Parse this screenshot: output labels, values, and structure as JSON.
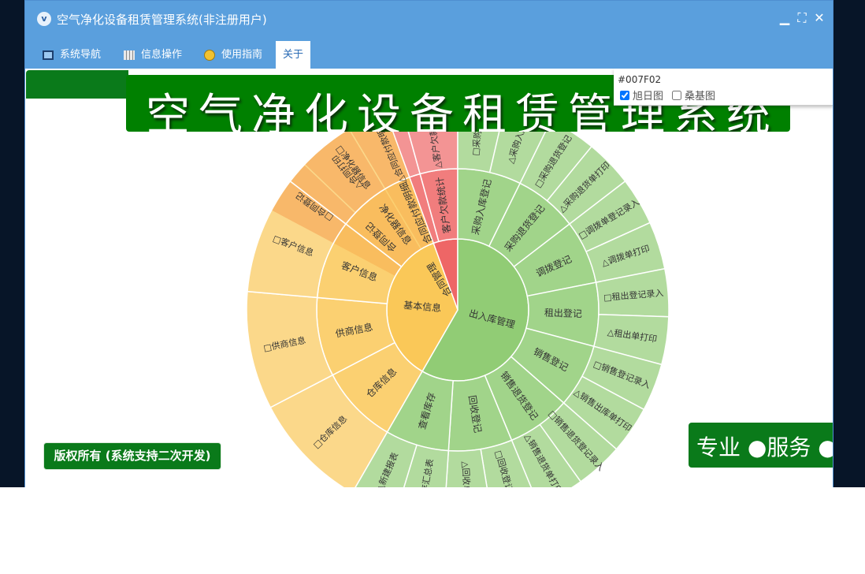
{
  "window": {
    "title": "空气净化设备租赁管理系统(非注册用户)",
    "logo_text": "v",
    "controls": {
      "minimize": "▁",
      "maximize": "⛶",
      "close": "✕"
    }
  },
  "menu": [
    {
      "label": "系统导航",
      "icon": "monitor-icon"
    },
    {
      "label": "信息操作",
      "icon": "grid-icon"
    },
    {
      "label": "使用指南",
      "icon": "help-icon"
    },
    {
      "label": "关于",
      "icon": ""
    }
  ],
  "banner": {
    "title": "空气净化设备租赁管理系统"
  },
  "popup": {
    "color": "#007F02",
    "options": [
      {
        "label": "旭日图",
        "checked": true
      },
      {
        "label": "桑基图",
        "checked": false
      }
    ]
  },
  "copyright": "版权所有 (系统支持二次开发)",
  "motto": "专业 ●服务 ●价",
  "colors": {
    "red": "#ee6666",
    "yellow": "#fac858",
    "green": "#91cc75",
    "titlebar": "#5a9fdd",
    "banner": "#008000"
  },
  "chart_data": {
    "type": "sunburst",
    "series": [
      {
        "name": "合同管理",
        "children": [
          {
            "name": "合同登记",
            "children": [
              {
                "name": "□合同登记"
              },
              {
                "name": "△合同打印"
              }
            ]
          },
          {
            "name": "合同应付款明细",
            "children": [
              {
                "name": "△合同应付款明细表"
              }
            ]
          },
          {
            "name": "客户欠款统计",
            "children": [
              {
                "name": "△客户欠款统计表"
              }
            ]
          }
        ]
      },
      {
        "name": "出入库管理",
        "children": [
          {
            "name": "采购入库登记",
            "children": [
              {
                "name": "□采购入库"
              },
              {
                "name": "△采购入库"
              }
            ]
          },
          {
            "name": "采购退货登记",
            "children": [
              {
                "name": "□采购退货登记"
              },
              {
                "name": "△采购退货单打印"
              }
            ]
          },
          {
            "name": "调拨登记",
            "children": [
              {
                "name": "□调拨单登记录入"
              },
              {
                "name": "△调拨单打印"
              }
            ]
          },
          {
            "name": "租出登记",
            "children": [
              {
                "name": "□租出登记录入"
              },
              {
                "name": "△租出单打印"
              }
            ]
          },
          {
            "name": "销售登记",
            "children": [
              {
                "name": "□销售登记录入"
              },
              {
                "name": "△销售出库单打印"
              }
            ]
          },
          {
            "name": "销售退货登记",
            "children": [
              {
                "name": "□销售退货登记录入"
              },
              {
                "name": "△销售退货单打印"
              }
            ]
          },
          {
            "name": "回收登记",
            "children": [
              {
                "name": "□回收登记录入"
              },
              {
                "name": "△回收单打印"
              }
            ]
          },
          {
            "name": "查看库存",
            "children": [
              {
                "name": "△库存汇总表"
              },
              {
                "name": "△新建报表"
              }
            ]
          }
        ]
      },
      {
        "name": "基本信息",
        "children": [
          {
            "name": "仓库信息",
            "children": [
              {
                "name": "□仓库信息"
              }
            ]
          },
          {
            "name": "供商信息",
            "children": [
              {
                "name": "□供商信息"
              }
            ]
          },
          {
            "name": "客户信息",
            "children": [
              {
                "name": "□客户信息"
              }
            ]
          },
          {
            "name": "净化器信息",
            "children": [
              {
                "name": "□净化器信息"
              }
            ]
          }
        ]
      }
    ]
  }
}
